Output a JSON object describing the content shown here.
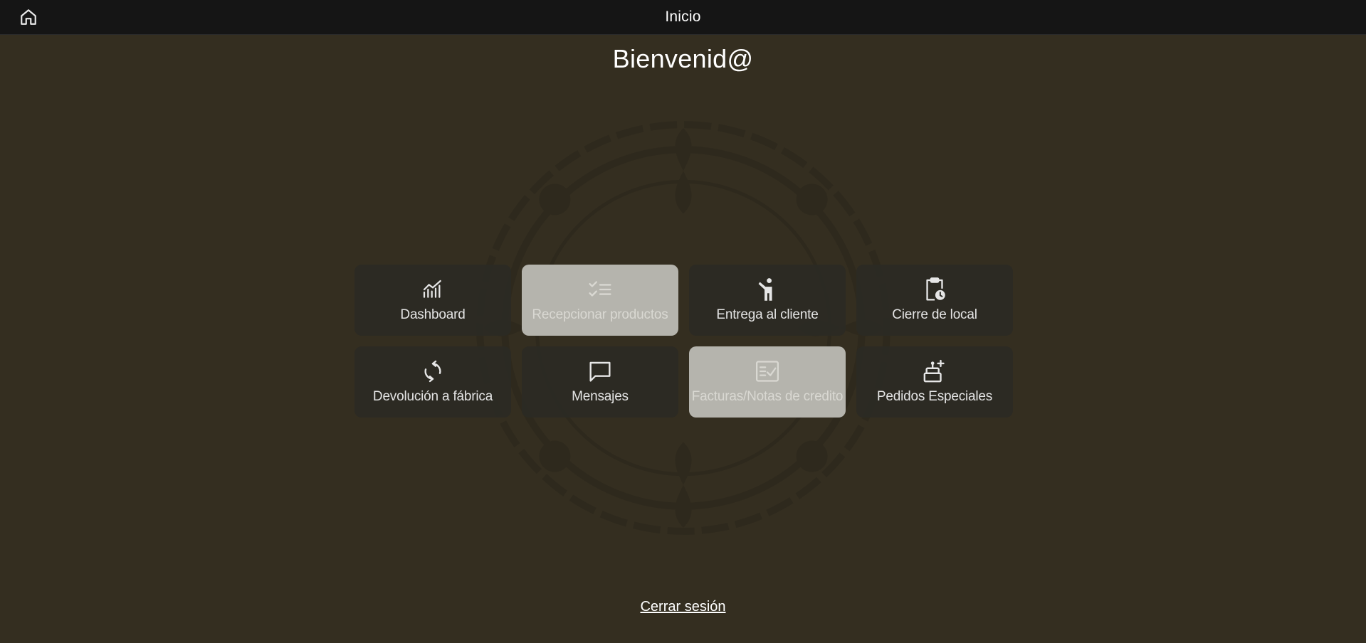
{
  "header": {
    "title": "Inicio",
    "home_icon": "home-icon"
  },
  "main": {
    "welcome": "Bienvenid@",
    "tiles": [
      {
        "label": "Dashboard",
        "icon": "chart-icon",
        "active": false
      },
      {
        "label": "Recepcionar productos",
        "icon": "checklist-icon",
        "active": true
      },
      {
        "label": "Entrega al cliente",
        "icon": "person-icon",
        "active": false
      },
      {
        "label": "Cierre de local",
        "icon": "clipboard-clock-icon",
        "active": false
      },
      {
        "label": "Devolución a fábrica",
        "icon": "refresh-icon",
        "active": false
      },
      {
        "label": "Mensajes",
        "icon": "message-icon",
        "active": false
      },
      {
        "label": "Facturas/Notas de credito",
        "icon": "invoice-check-icon",
        "active": true
      },
      {
        "label": "Pedidos Especiales",
        "icon": "cake-plus-icon",
        "active": false
      }
    ]
  },
  "footer": {
    "logout_label": "Cerrar sesión"
  },
  "colors": {
    "background": "#342e20",
    "topbar": "#151515",
    "tile": "#2b2a24",
    "tile_active": "#b5b4ad"
  }
}
